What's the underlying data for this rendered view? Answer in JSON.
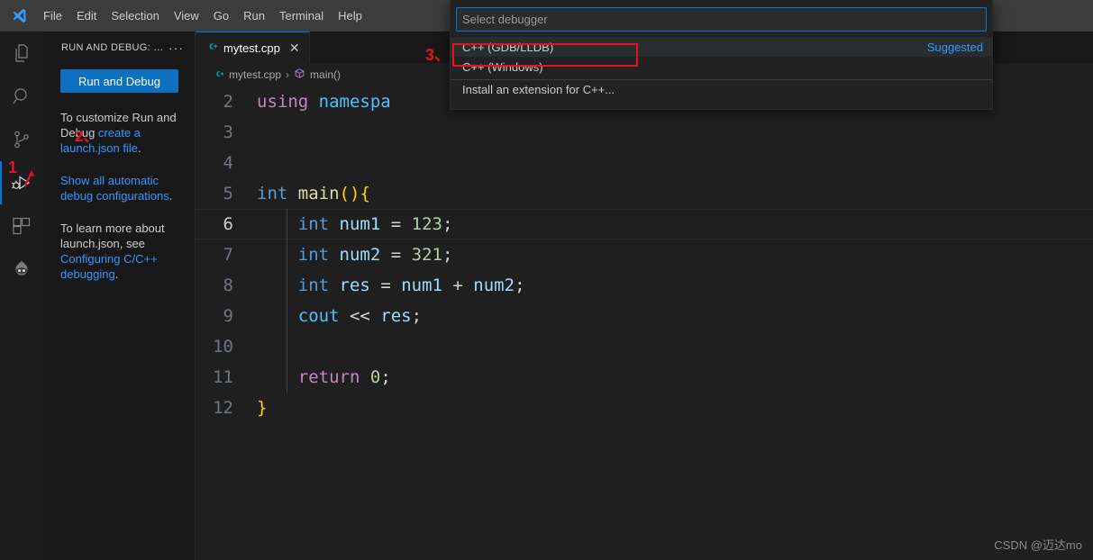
{
  "titlebar": {
    "logo_icon": "vscode-logo",
    "menus": [
      "File",
      "Edit",
      "Selection",
      "View",
      "Go",
      "Run",
      "Terminal",
      "Help"
    ]
  },
  "activitybar": {
    "items": [
      {
        "name": "explorer",
        "icon": "files-icon",
        "active": false
      },
      {
        "name": "search",
        "icon": "search-icon",
        "active": false
      },
      {
        "name": "source-control",
        "icon": "source-control-icon",
        "active": false
      },
      {
        "name": "run-and-debug",
        "icon": "run-and-debug-icon",
        "active": true
      },
      {
        "name": "extensions",
        "icon": "extensions-icon",
        "active": false
      },
      {
        "name": "account-bot",
        "icon": "robot-icon",
        "active": false
      }
    ]
  },
  "sidebar": {
    "title": "RUN AND DEBUG: R...",
    "more_label": "···",
    "run_debug_button": "Run and Debug",
    "paragraph1": {
      "pre": "To customize Run and Debug ",
      "link": "create a launch.json file",
      "post": "."
    },
    "paragraph2": {
      "link": "Show all automatic debug configurations",
      "post": "."
    },
    "paragraph3": {
      "pre": "To learn more about launch.json, see ",
      "link": "Configuring C/C++ debugging",
      "post": "."
    }
  },
  "editor": {
    "tab": {
      "label": "mytest.cpp",
      "file_icon": "cpp-file-icon",
      "close_icon": "close-icon"
    },
    "breadcrumbs": [
      {
        "label": "mytest.cpp",
        "icon": "cpp-file-icon"
      },
      {
        "label": "main()",
        "icon": "symbol-method-icon"
      }
    ],
    "breadcrumb_separator": "›",
    "lines": [
      {
        "number": "2",
        "tokens": [
          {
            "t": "using",
            "c": "kp"
          },
          {
            "t": " ",
            "c": "pl"
          },
          {
            "t": "namespa",
            "c": "ns"
          }
        ],
        "indent": false,
        "current": false
      },
      {
        "number": "3",
        "tokens": [],
        "indent": false,
        "current": false
      },
      {
        "number": "4",
        "tokens": [],
        "indent": false,
        "current": false
      },
      {
        "number": "5",
        "tokens": [
          {
            "t": "int",
            "c": "k"
          },
          {
            "t": " ",
            "c": "pl"
          },
          {
            "t": "main",
            "c": "fn"
          },
          {
            "t": "()",
            "c": "br"
          },
          {
            "t": "{",
            "c": "br"
          }
        ],
        "indent": false,
        "current": false
      },
      {
        "number": "6",
        "tokens": [
          {
            "t": "    ",
            "c": "pl"
          },
          {
            "t": "int",
            "c": "k"
          },
          {
            "t": " ",
            "c": "pl"
          },
          {
            "t": "num1",
            "c": "id"
          },
          {
            "t": " = ",
            "c": "op"
          },
          {
            "t": "123",
            "c": "num"
          },
          {
            "t": ";",
            "c": "op"
          }
        ],
        "indent": true,
        "current": true
      },
      {
        "number": "7",
        "tokens": [
          {
            "t": "    ",
            "c": "pl"
          },
          {
            "t": "int",
            "c": "k"
          },
          {
            "t": " ",
            "c": "pl"
          },
          {
            "t": "num2",
            "c": "id"
          },
          {
            "t": " = ",
            "c": "op"
          },
          {
            "t": "321",
            "c": "num"
          },
          {
            "t": ";",
            "c": "op"
          }
        ],
        "indent": true,
        "current": false
      },
      {
        "number": "8",
        "tokens": [
          {
            "t": "    ",
            "c": "pl"
          },
          {
            "t": "int",
            "c": "k"
          },
          {
            "t": " ",
            "c": "pl"
          },
          {
            "t": "res",
            "c": "id"
          },
          {
            "t": " = ",
            "c": "op"
          },
          {
            "t": "num1",
            "c": "id"
          },
          {
            "t": " + ",
            "c": "op"
          },
          {
            "t": "num2",
            "c": "id"
          },
          {
            "t": ";",
            "c": "op"
          }
        ],
        "indent": true,
        "current": false
      },
      {
        "number": "9",
        "tokens": [
          {
            "t": "    ",
            "c": "pl"
          },
          {
            "t": "cout",
            "c": "ns"
          },
          {
            "t": " << ",
            "c": "op"
          },
          {
            "t": "res",
            "c": "id"
          },
          {
            "t": ";",
            "c": "op"
          }
        ],
        "indent": true,
        "current": false
      },
      {
        "number": "10",
        "tokens": [],
        "indent": true,
        "current": false
      },
      {
        "number": "11",
        "tokens": [
          {
            "t": "    ",
            "c": "pl"
          },
          {
            "t": "return",
            "c": "kp"
          },
          {
            "t": " ",
            "c": "pl"
          },
          {
            "t": "0",
            "c": "num"
          },
          {
            "t": ";",
            "c": "op"
          }
        ],
        "indent": true,
        "current": false
      },
      {
        "number": "12",
        "tokens": [
          {
            "t": "}",
            "c": "br"
          }
        ],
        "indent": false,
        "current": false
      }
    ]
  },
  "quickpick": {
    "placeholder": "Select debugger",
    "value": "",
    "options": [
      {
        "label": "C++ (GDB/LLDB)",
        "badge": "Suggested",
        "selected": true,
        "separator_above": false
      },
      {
        "label": "C++ (Windows)",
        "badge": "",
        "selected": false,
        "separator_above": false
      },
      {
        "label": "Install an extension for C++...",
        "badge": "",
        "selected": false,
        "separator_above": true
      }
    ]
  },
  "annotations": [
    {
      "name": "annotation-1",
      "text": "1"
    },
    {
      "name": "annotation-2",
      "text": "2、"
    },
    {
      "name": "annotation-3",
      "text": "3、"
    }
  ],
  "watermark": "CSDN @迈达mo",
  "colors": {
    "accent": "#0078d4",
    "link": "#3794ff",
    "annotation_red": "#e81123",
    "editor_bg": "#1f1f1f",
    "sidebar_bg": "#181818"
  }
}
